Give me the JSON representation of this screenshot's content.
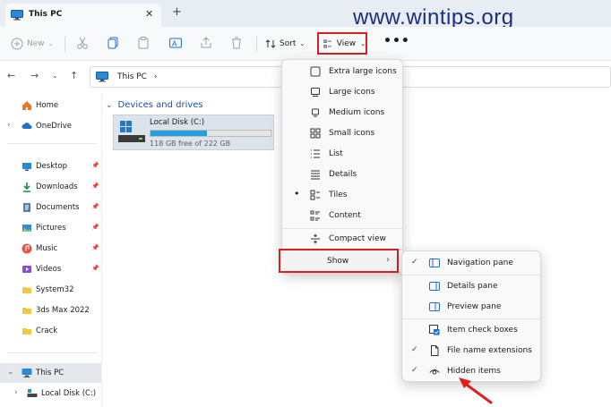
{
  "window": {
    "tab_title": "This PC",
    "close_glyph": "✕",
    "add_glyph": "+"
  },
  "watermark": "www.wintips.org",
  "toolbar": {
    "new_label": "New",
    "sort_label": "Sort",
    "view_label": "View",
    "more_label": "•••"
  },
  "navigation": {
    "address_path": "This PC",
    "address_chevron": "›"
  },
  "sidebar": {
    "home": "Home",
    "onedrive": "OneDrive",
    "quick_access": [
      {
        "label": "Desktop",
        "icon": "desktop-icon"
      },
      {
        "label": "Downloads",
        "icon": "download-icon"
      },
      {
        "label": "Documents",
        "icon": "documents-icon"
      },
      {
        "label": "Pictures",
        "icon": "pictures-icon"
      },
      {
        "label": "Music",
        "icon": "music-icon"
      },
      {
        "label": "Videos",
        "icon": "videos-icon"
      },
      {
        "label": "System32",
        "icon": "folder-icon"
      },
      {
        "label": "3ds Max 2022",
        "icon": "folder-icon"
      },
      {
        "label": "Crack",
        "icon": "folder-icon"
      }
    ],
    "this_pc": "This PC",
    "local_disk": "Local Disk (C:)"
  },
  "content": {
    "group_header": "Devices and drives",
    "drive": {
      "name": "Local Disk (C:)",
      "free_text": "118 GB free of 222 GB",
      "used_fraction": 0.47
    }
  },
  "view_menu": {
    "items": [
      {
        "label": "Extra large icons",
        "icon": "extra-large-icons-icon"
      },
      {
        "label": "Large icons",
        "icon": "large-icons-icon"
      },
      {
        "label": "Medium icons",
        "icon": "medium-icons-icon"
      },
      {
        "label": "Small icons",
        "icon": "small-icons-icon"
      },
      {
        "label": "List",
        "icon": "list-icon"
      },
      {
        "label": "Details",
        "icon": "details-icon"
      },
      {
        "label": "Tiles",
        "icon": "tiles-icon",
        "selected": true
      },
      {
        "label": "Content",
        "icon": "content-icon"
      }
    ],
    "compact_label": "Compact view",
    "show_label": "Show",
    "selected_bullet": "•",
    "submenu_arrow": "›"
  },
  "show_menu": {
    "items": [
      {
        "label": "Navigation pane",
        "checked": true
      },
      {
        "label": "Details pane",
        "checked": false
      },
      {
        "label": "Preview pane",
        "checked": false
      },
      {
        "label": "Item check boxes",
        "checked": false
      },
      {
        "label": "File name extensions",
        "checked": true
      },
      {
        "label": "Hidden items",
        "checked": true
      }
    ],
    "check_glyph": "✓"
  },
  "colors": {
    "accent": "#26a0da",
    "highlight_border": "#d42020",
    "group_header": "#1b4fa0",
    "watermark": "#1c2e80"
  }
}
